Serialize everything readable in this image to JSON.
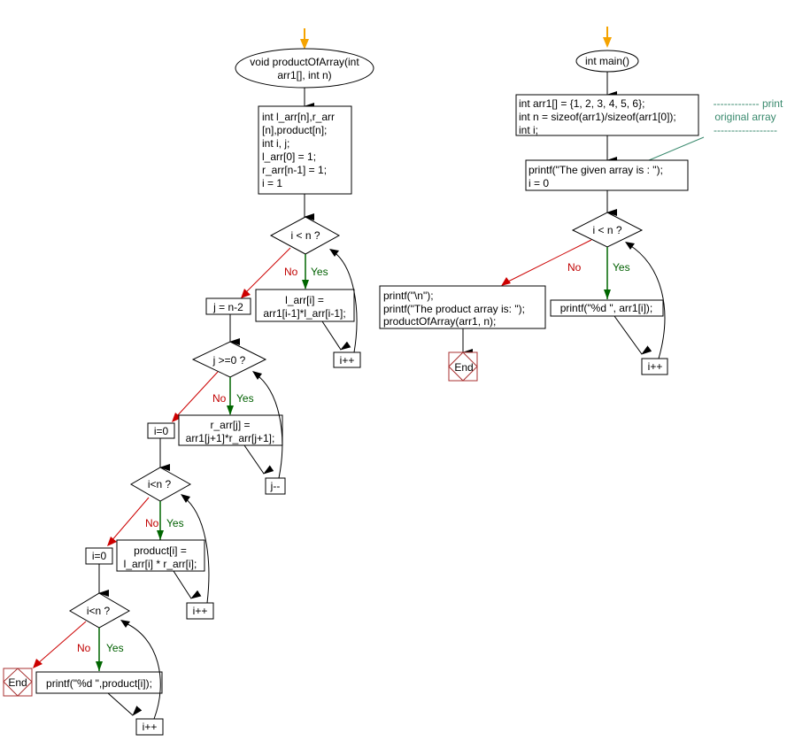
{
  "colors": {
    "start_arrow": "#f5a300",
    "no_branch": "#cc0000",
    "yes_branch": "#006600",
    "end_box": "#a83232",
    "comment": "#3a8a6e"
  },
  "labels": {
    "no": "No",
    "yes": "Yes",
    "end": "End"
  },
  "left_flow": {
    "start": [
      "void productOfArray(int",
      "arr1[], int n)"
    ],
    "init_block": [
      "int l_arr[n],r_arr",
      "[n],product[n];",
      "int i, j;",
      "l_arr[0] = 1;",
      "r_arr[n-1] = 1;",
      "i = 1"
    ],
    "loop1": {
      "condition": "i < n ?",
      "body": [
        "l_arr[i] =",
        "arr1[i-1]*l_arr[i-1];"
      ],
      "increment": "i++",
      "exit": "j = n-2"
    },
    "loop2": {
      "condition": "j >=0 ?",
      "body": [
        "r_arr[j] =",
        "arr1[j+1]*r_arr[j+1];"
      ],
      "increment": "j--",
      "exit": "i=0"
    },
    "loop3": {
      "condition": "i<n ?",
      "body": [
        "product[i] =",
        "l_arr[i] * r_arr[i];"
      ],
      "increment": "i++",
      "exit": "i=0"
    },
    "loop4": {
      "condition": "i<n ?",
      "body": "printf(\"%d \",product[i]);",
      "increment": "i++"
    }
  },
  "right_flow": {
    "start": "int main()",
    "init_block": [
      "int arr1[] = {1, 2, 3, 4, 5, 6};",
      "int n = sizeof(arr1)/sizeof(arr1[0]);",
      "int i;"
    ],
    "comment": [
      "------------- print",
      "original array",
      "------------------"
    ],
    "print_block": [
      "printf(\"The given array is :  \");",
      "i = 0"
    ],
    "loop": {
      "condition": "i < n ?",
      "body": "printf(\"%d  \", arr1[i]);",
      "increment": "i++"
    },
    "exit_block": [
      "printf(\"\\n\");",
      "printf(\"The product array is: \");",
      "productOfArray(arr1, n);"
    ]
  }
}
